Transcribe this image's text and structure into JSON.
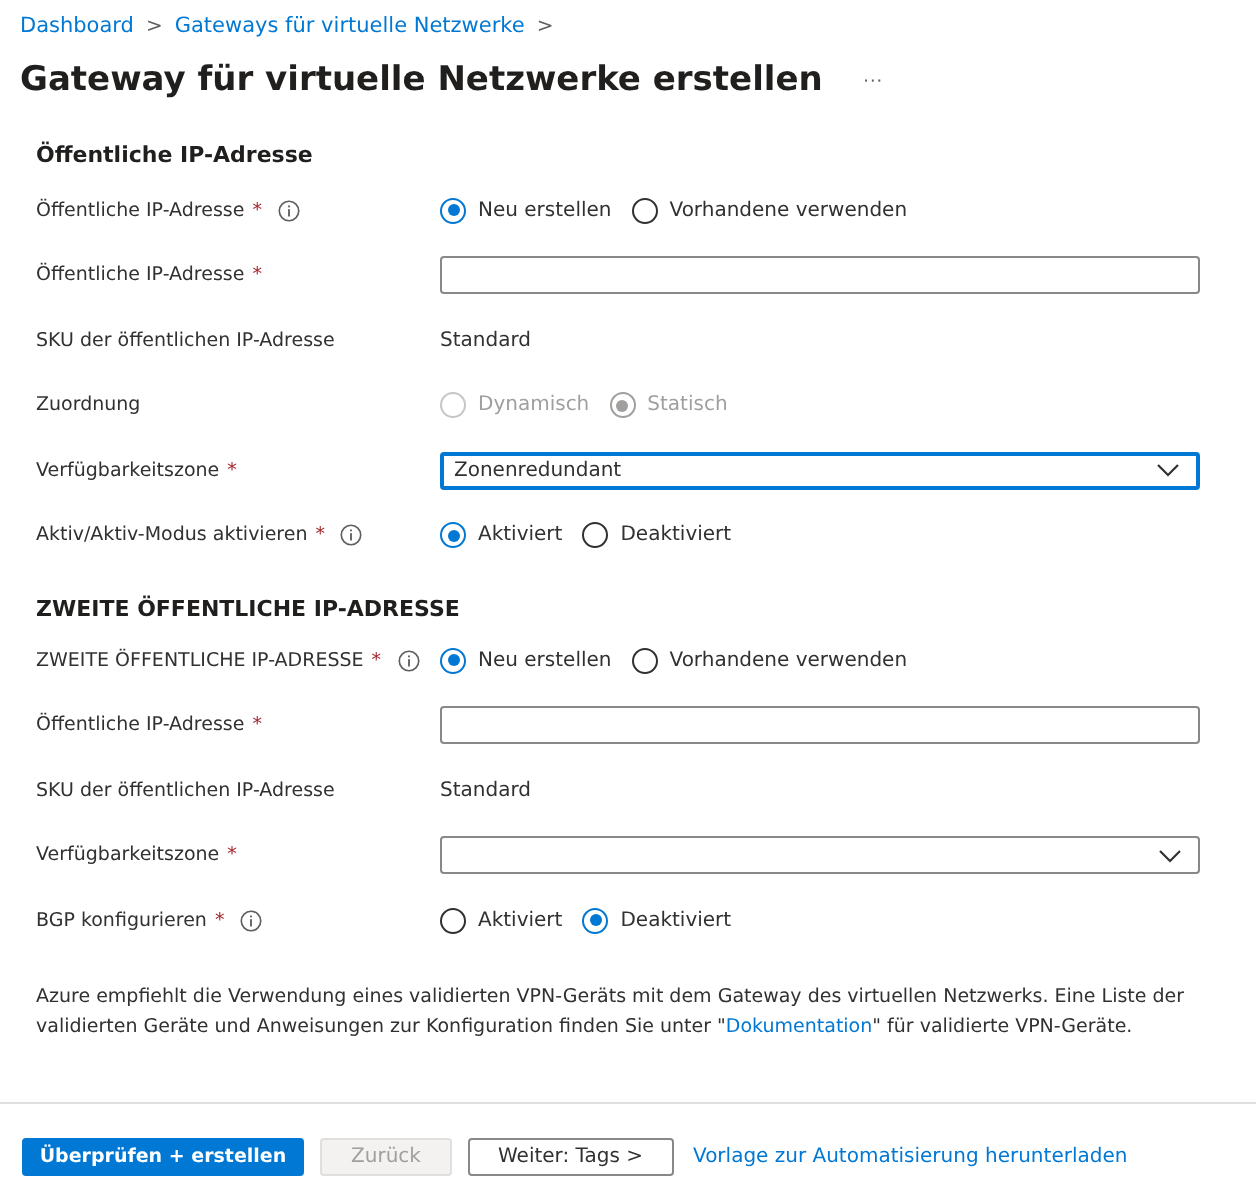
{
  "breadcrumb": {
    "items": [
      "Dashboard",
      "Gateways für virtuelle Netzwerke"
    ],
    "separator": ">"
  },
  "title": "Gateway für virtuelle Netzwerke erstellen",
  "more": "···",
  "sections": [
    {
      "heading": "Öffentliche IP-Adresse",
      "rows": [
        {
          "kind": "radio",
          "label": "Öffentliche IP-Adresse",
          "required": "*",
          "info": true,
          "options": [
            {
              "label": "Neu erstellen",
              "selected": true,
              "disabled": false
            },
            {
              "label": "Vorhandene verwenden",
              "selected": false,
              "disabled": false
            }
          ]
        },
        {
          "kind": "text",
          "label": "Öffentliche IP-Adresse",
          "required": "*"
        },
        {
          "kind": "static",
          "label": "SKU der öffentlichen IP-Adresse",
          "value": "Standard"
        },
        {
          "kind": "radio",
          "label": "Zuordnung",
          "options": [
            {
              "label": "Dynamisch",
              "selected": false,
              "disabled": true
            },
            {
              "label": "Statisch",
              "selected": true,
              "disabled": true
            }
          ]
        },
        {
          "kind": "select",
          "label": "Verfügbarkeitszone",
          "required": "*",
          "value": "Zonenredundant",
          "focused": true
        },
        {
          "kind": "radio",
          "label": "Aktiv/Aktiv-Modus aktivieren",
          "required": "*",
          "info": true,
          "options": [
            {
              "label": "Aktiviert",
              "selected": true,
              "disabled": false
            },
            {
              "label": "Deaktiviert",
              "selected": false,
              "disabled": false
            }
          ]
        }
      ]
    },
    {
      "heading": "ZWEITE ÖFFENTLICHE IP-ADRESSE",
      "rows": [
        {
          "kind": "radio",
          "label": "ZWEITE ÖFFENTLICHE IP-ADRESSE",
          "required": "*",
          "info": true,
          "options": [
            {
              "label": "Neu erstellen",
              "selected": true,
              "disabled": false
            },
            {
              "label": "Vorhandene verwenden",
              "selected": false,
              "disabled": false
            }
          ]
        },
        {
          "kind": "text",
          "label": "Öffentliche IP-Adresse",
          "required": "*"
        },
        {
          "kind": "static",
          "label": "SKU der öffentlichen IP-Adresse",
          "value": "Standard"
        },
        {
          "kind": "select",
          "label": "Verfügbarkeitszone",
          "required": "*",
          "focused": false
        },
        {
          "kind": "radio",
          "label": "BGP konfigurieren",
          "required": "*",
          "info": true,
          "options": [
            {
              "label": "Aktiviert",
              "selected": false,
              "disabled": false
            },
            {
              "label": "Deaktiviert",
              "selected": true,
              "disabled": false
            }
          ]
        }
      ]
    }
  ],
  "note": {
    "before": "Azure empfiehlt die Verwendung eines validierten VPN-Geräts mit dem Gateway des virtuellen Netzwerks. Eine Liste der validierten Geräte und Anweisungen zur Konfiguration finden Sie unter \"",
    "link": "Dokumentation",
    "after": "\" für validierte VPN-Geräte."
  },
  "buttons": [
    {
      "label": "Überprüfen + erstellen",
      "kind": "primary",
      "disabled": false
    },
    {
      "label": "Zurück",
      "kind": "secondary",
      "disabled": true
    },
    {
      "label": "Weiter: Tags >",
      "kind": "secondary",
      "disabled": false
    }
  ],
  "footer_link": "Vorlage zur Automatisierung herunterladen"
}
